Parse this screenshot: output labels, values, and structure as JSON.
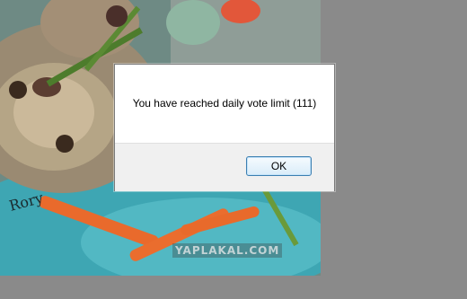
{
  "dialog": {
    "message": "You have reached daily vote limit (111)",
    "ok_label": "OK"
  },
  "background": {
    "watermark": "YAPLAKAL.COM",
    "handwriting": "Rory"
  }
}
